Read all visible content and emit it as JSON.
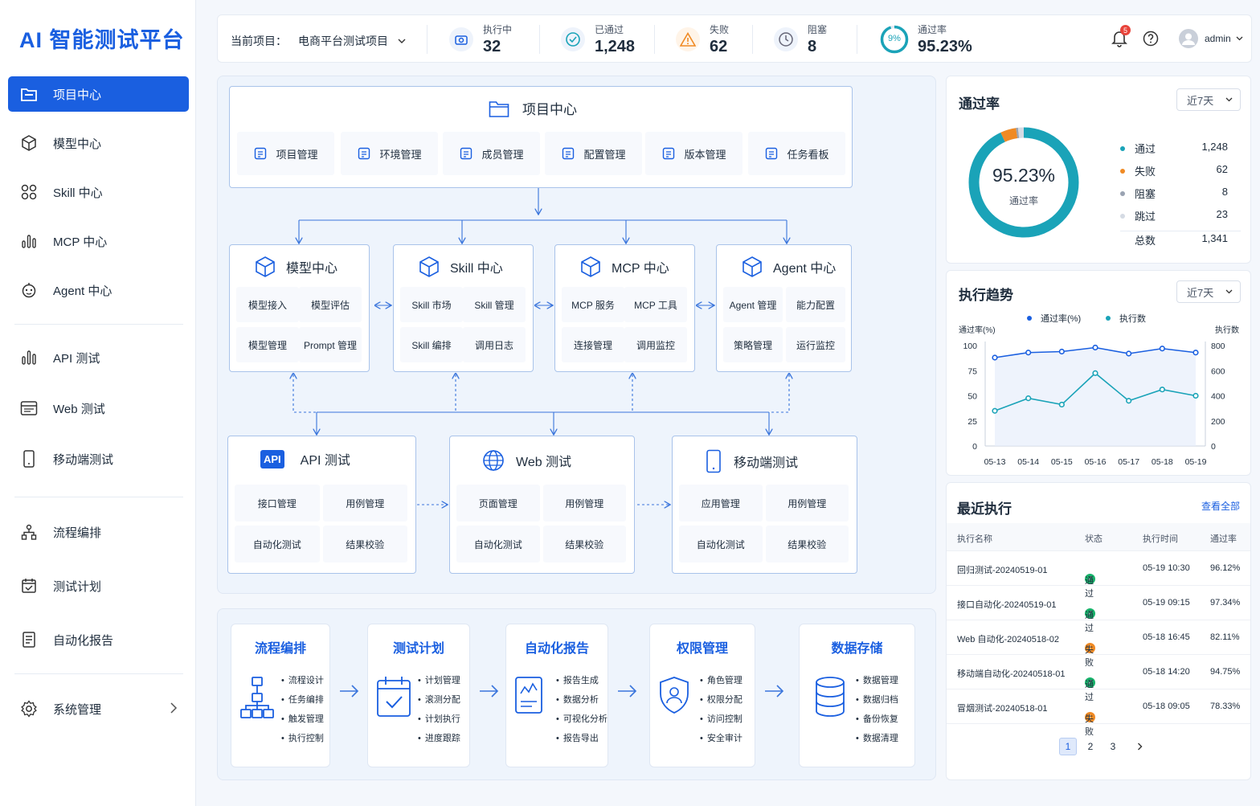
{
  "brand": "AI 智能测试平台",
  "nav": [
    {
      "label": "项目中心",
      "icon": "folder-icon",
      "active": true
    },
    {
      "label": "模型中心",
      "icon": "cube-icon"
    },
    {
      "label": "Skill 中心",
      "icon": "grid-icon"
    },
    {
      "label": "MCP 中心",
      "icon": "chart-icon"
    },
    {
      "label": "Agent 中心",
      "icon": "robot-icon"
    },
    {
      "label": "API 测试",
      "icon": "api-icon"
    },
    {
      "label": "Web 测试",
      "icon": "browser-icon"
    },
    {
      "label": "移动端测试",
      "icon": "mobile-icon"
    },
    {
      "label": "流程编排",
      "icon": "flow-icon"
    },
    {
      "label": "测试计划",
      "icon": "calendar-icon"
    },
    {
      "label": "自动化报告",
      "icon": "report-icon"
    },
    {
      "label": "系统管理",
      "icon": "gear-icon"
    }
  ],
  "header": {
    "project_label": "当前项目：",
    "project_value": "电商平台测试项目",
    "stats": [
      {
        "label": "执行中",
        "value": "32",
        "icon": "camera-icon"
      },
      {
        "label": "已通过",
        "value": "1,248",
        "icon": "check-circle-icon"
      },
      {
        "label": "失败",
        "value": "62",
        "icon": "warning-icon"
      },
      {
        "label": "阻塞",
        "value": "8",
        "icon": "blocked-icon"
      },
      {
        "label": "通过率",
        "value": "95.23%",
        "ring": "9%",
        "icon": "ring-icon"
      }
    ],
    "notify_count": "5",
    "user": "admin"
  },
  "project_center": {
    "title": "项目中心",
    "items": [
      "项目管理",
      "环境管理",
      "成员管理",
      "配置管理",
      "版本管理",
      "任务看板"
    ]
  },
  "centers": [
    {
      "title": "模型中心",
      "cells": [
        "模型接入",
        "模型评估",
        "模型管理",
        "Prompt 管理"
      ]
    },
    {
      "title": "Skill 中心",
      "cells": [
        "Skill 市场",
        "Skill 管理",
        "Skill 编排",
        "调用日志"
      ]
    },
    {
      "title": "MCP 中心",
      "cells": [
        "MCP 服务",
        "MCP 工具",
        "连接管理",
        "调用监控"
      ]
    },
    {
      "title": "Agent 中心",
      "cells": [
        "Agent 管理",
        "能力配置",
        "策略管理",
        "运行监控"
      ]
    }
  ],
  "tests": [
    {
      "title": "API 测试",
      "badge": "API",
      "cells": [
        "接口管理",
        "用例管理",
        "自动化测试",
        "结果校验"
      ]
    },
    {
      "title": "Web 测试",
      "cells": [
        "页面管理",
        "用例管理",
        "自动化测试",
        "结果校验"
      ]
    },
    {
      "title": "移动端测试",
      "cells": [
        "应用管理",
        "用例管理",
        "自动化测试",
        "结果校验"
      ]
    }
  ],
  "bottom": [
    {
      "title": "流程编排",
      "items": [
        "流程设计",
        "任务编排",
        "触发管理",
        "执行控制"
      ]
    },
    {
      "title": "测试计划",
      "items": [
        "计划管理",
        "滚测分配",
        "计划执行",
        "进度跟踪"
      ]
    },
    {
      "title": "自动化报告",
      "items": [
        "报告生成",
        "数据分析",
        "可视化分析",
        "报告导出"
      ]
    },
    {
      "title": "权限管理",
      "items": [
        "角色管理",
        "权限分配",
        "访问控制",
        "安全审计"
      ]
    },
    {
      "title": "数据存储",
      "items": [
        "数据管理",
        "数据归档",
        "备份恢复",
        "数据清理"
      ]
    }
  ],
  "pass_rate": {
    "title": "通过率",
    "range": "近7天",
    "value": "95.23%",
    "sub": "通过率",
    "legend": [
      {
        "label": "通过",
        "value": "1,248",
        "color": "#1aa3b8",
        "count": 1248
      },
      {
        "label": "失败",
        "value": "62",
        "color": "#f08a24",
        "count": 62
      },
      {
        "label": "阻塞",
        "value": "8",
        "color": "#9aa3b2",
        "count": 8
      },
      {
        "label": "跳过",
        "value": "23",
        "color": "#d5dbe4",
        "count": 23
      }
    ],
    "total_label": "总数",
    "total_value": "1,341"
  },
  "trend": {
    "title": "执行趋势",
    "range": "近7天"
  },
  "chart_data": {
    "type": "line",
    "x": [
      "05-13",
      "05-14",
      "05-15",
      "05-16",
      "05-17",
      "05-18",
      "05-19"
    ],
    "series": [
      {
        "name": "通过率(%)",
        "axis": "left",
        "color": "#1a5fe0",
        "values": [
          88,
          93,
          94,
          98,
          92,
          97,
          93
        ]
      },
      {
        "name": "执行数",
        "axis": "right",
        "color": "#1aa3b8",
        "values": [
          280,
          380,
          330,
          580,
          360,
          450,
          400
        ]
      }
    ],
    "ylabel_left": "通过率(%)",
    "ylabel_right": "执行数",
    "ylim_left": [
      0,
      100
    ],
    "ylim_right": [
      0,
      800
    ],
    "yticks_left": [
      "100",
      "75",
      "50",
      "25",
      "0"
    ],
    "yticks_right": [
      "800",
      "600",
      "400",
      "200",
      "0"
    ],
    "legend": "top"
  },
  "recent": {
    "title": "最近执行",
    "view_all": "查看全部",
    "cols": [
      "执行名称",
      "状态",
      "执行时间",
      "通过率"
    ],
    "rows": [
      {
        "name": "回归测试-20240519-01",
        "status": "通过",
        "ok": true,
        "time": "05-19 10:30",
        "rate": "96.12%"
      },
      {
        "name": "接口自动化-20240519-01",
        "status": "通过",
        "ok": true,
        "time": "05-19 09:15",
        "rate": "97.34%"
      },
      {
        "name": "Web 自动化-20240518-02",
        "status": "失败",
        "ok": false,
        "time": "05-18 16:45",
        "rate": "82.11%"
      },
      {
        "name": "移动端自动化-20240518-01",
        "status": "通过",
        "ok": true,
        "time": "05-18 14:20",
        "rate": "94.75%"
      },
      {
        "name": "冒烟测试-20240518-01",
        "status": "失败",
        "ok": false,
        "time": "05-18 09:05",
        "rate": "78.33%"
      }
    ],
    "pages": [
      "1",
      "2",
      "3"
    ]
  }
}
